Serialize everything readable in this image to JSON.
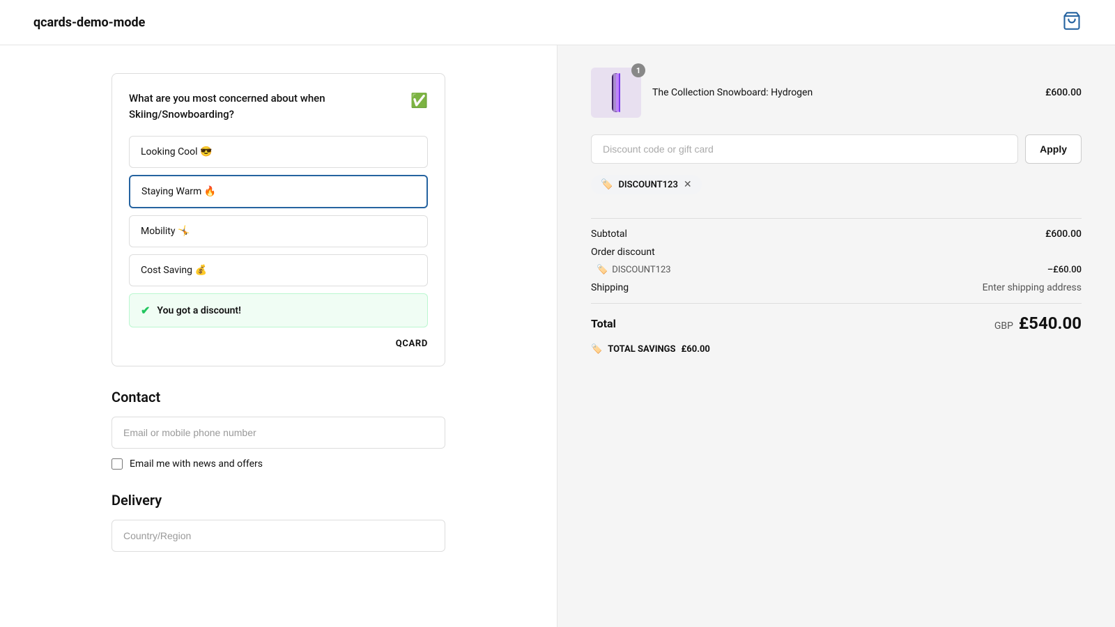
{
  "header": {
    "title": "qcards-demo-mode",
    "cart_icon": "shopping-bag-icon"
  },
  "qcard": {
    "question": "What are you most concerned about when Skiing/Snowboarding?",
    "options": [
      {
        "id": "looking-cool",
        "label": "Looking Cool 😎",
        "selected": false
      },
      {
        "id": "staying-warm",
        "label": "Staying Warm 🔥",
        "selected": true
      },
      {
        "id": "mobility",
        "label": "Mobility 🤸",
        "selected": false
      },
      {
        "id": "cost-saving",
        "label": "Cost Saving 💰",
        "selected": false
      }
    ],
    "discount_banner": "You got a discount!",
    "brand_label": "QCARD"
  },
  "contact": {
    "section_title": "Contact",
    "email_placeholder": "Email or mobile phone number",
    "checkbox_label": "Email me with news and offers"
  },
  "delivery": {
    "section_title": "Delivery",
    "country_placeholder": "Country/Region"
  },
  "order_summary": {
    "product_name": "The Collection Snowboard: Hydrogen",
    "product_price": "£600.00",
    "product_badge": "1",
    "discount_input_placeholder": "Discount code or gift card",
    "apply_button_label": "Apply",
    "applied_code": "DISCOUNT123",
    "subtotal_label": "Subtotal",
    "subtotal_value": "£600.00",
    "order_discount_label": "Order discount",
    "discount_code_label": "DISCOUNT123",
    "discount_value": "–£60.00",
    "shipping_label": "Shipping",
    "shipping_value": "Enter shipping address",
    "total_label": "Total",
    "total_currency": "GBP",
    "total_value": "£540.00",
    "savings_label": "TOTAL SAVINGS",
    "savings_value": "£60.00"
  }
}
